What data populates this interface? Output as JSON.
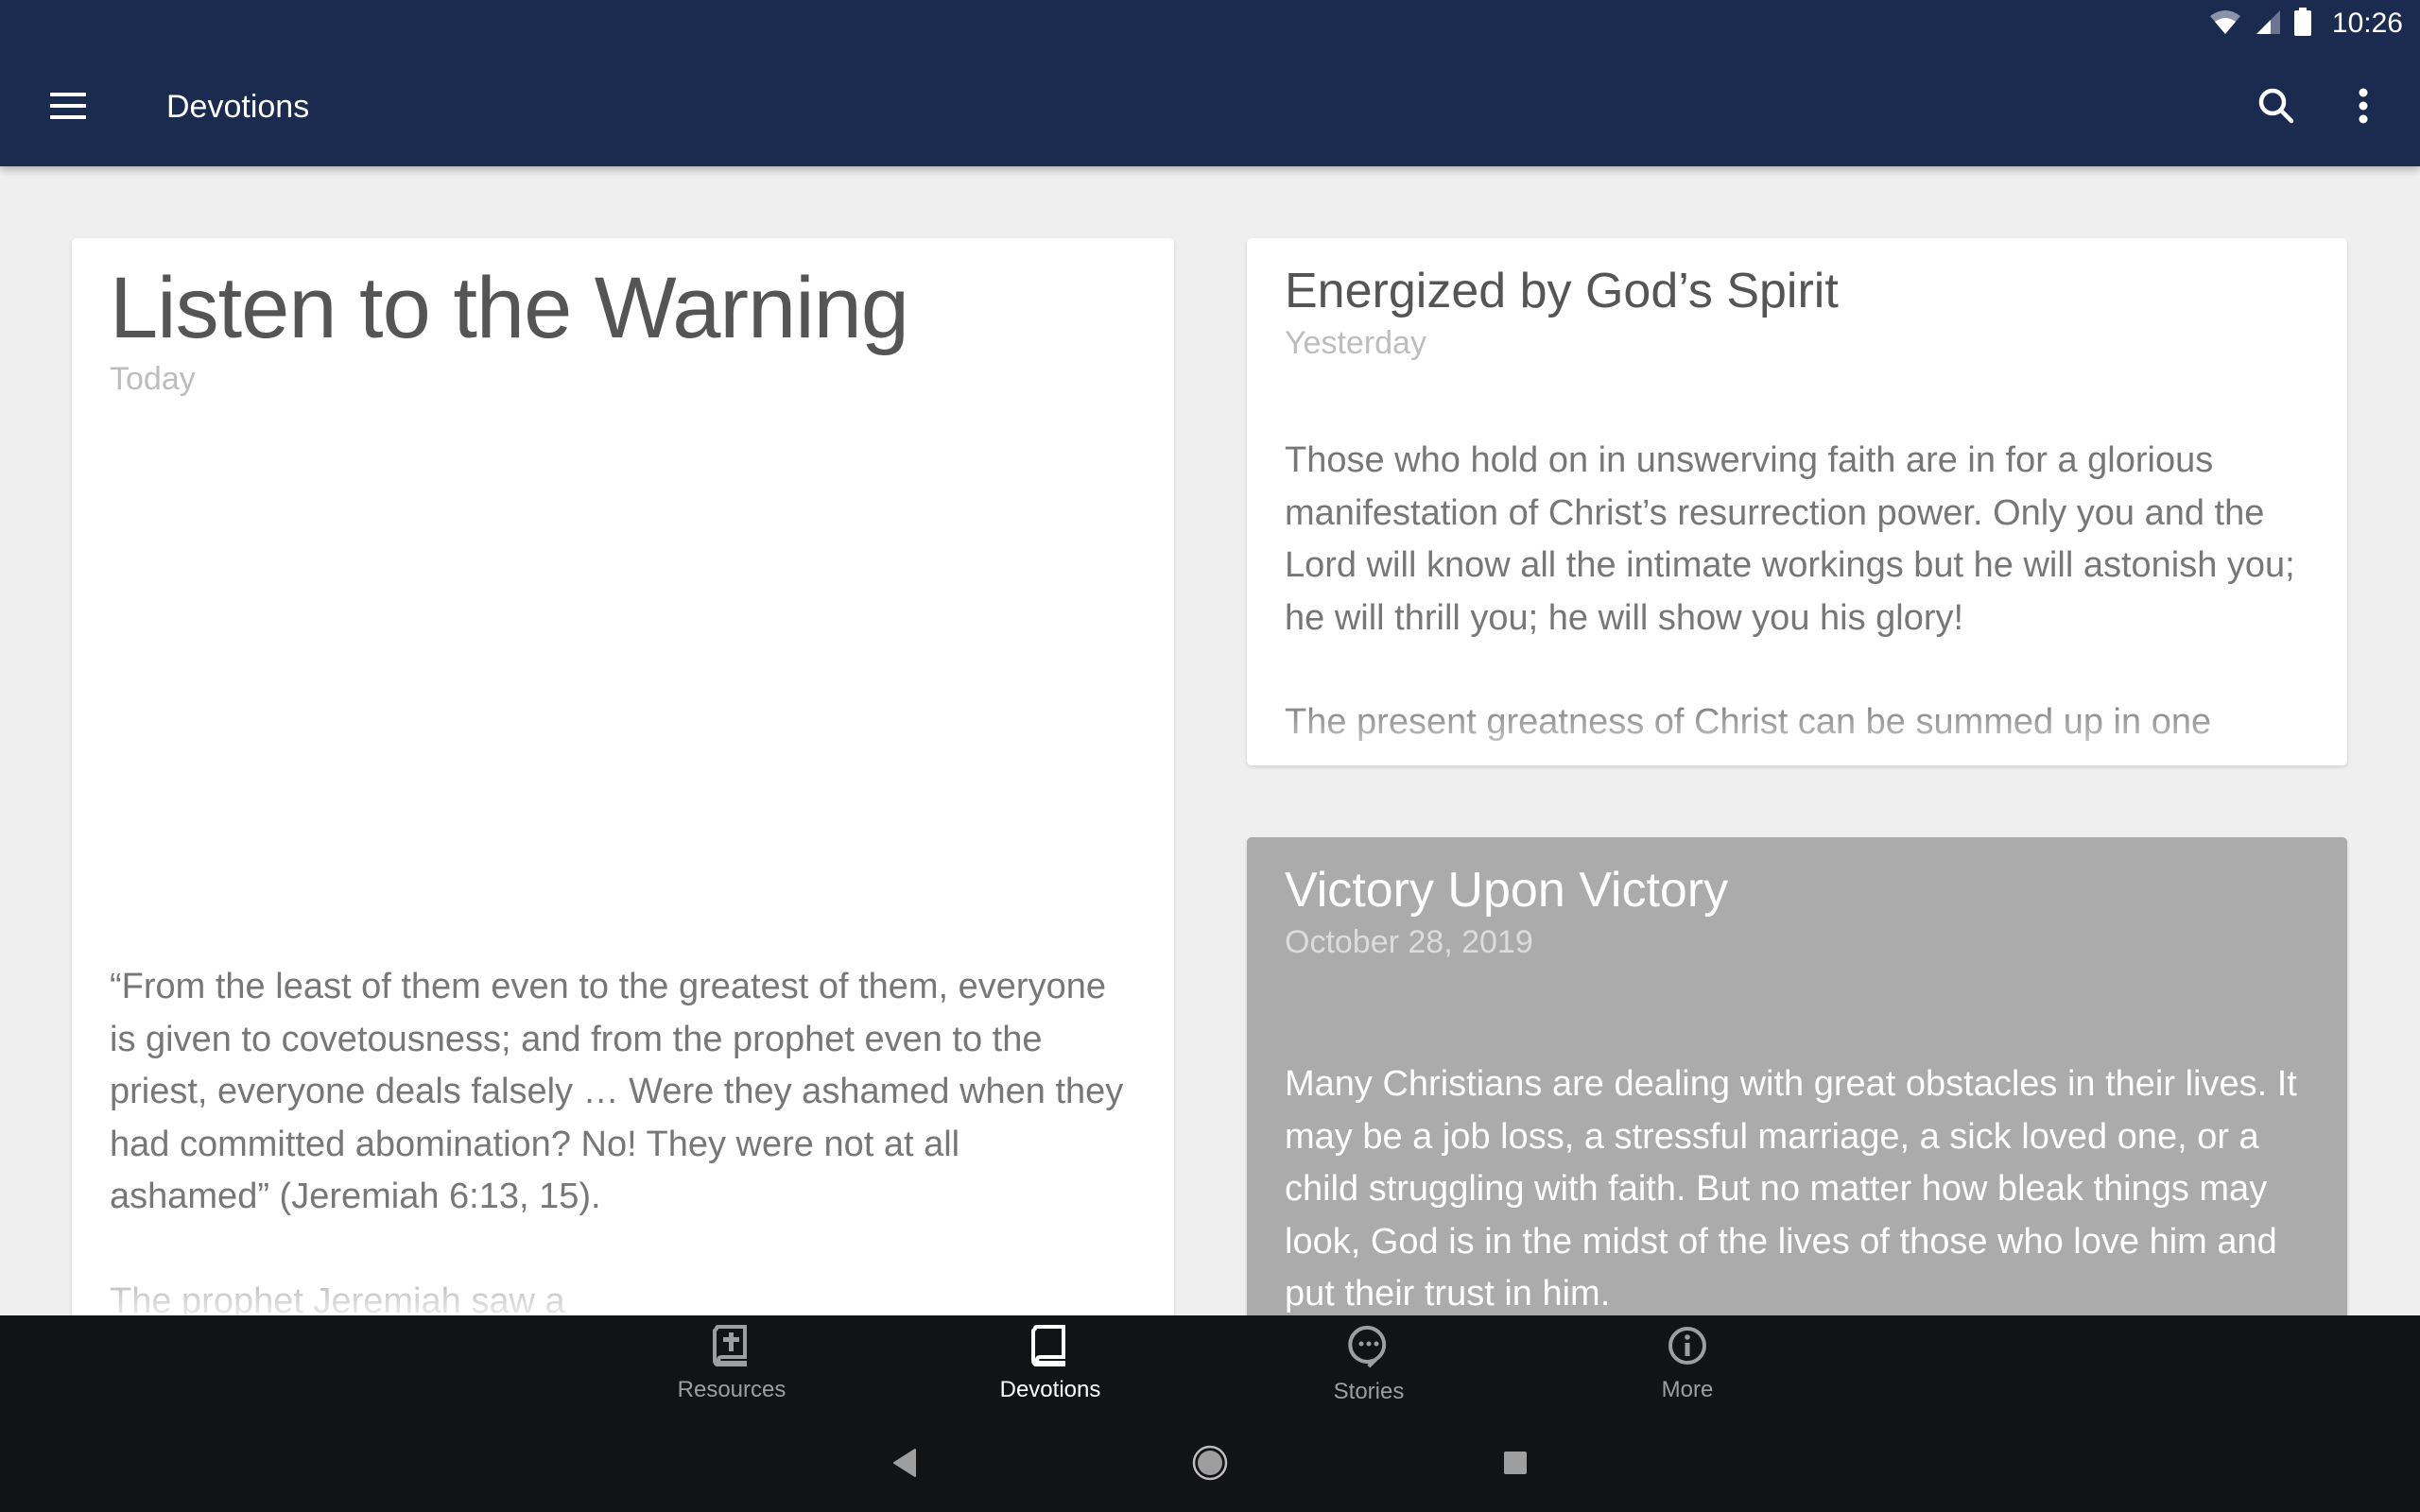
{
  "status_bar": {
    "time": "10:26",
    "icons": [
      "wifi-icon",
      "cell-signal-icon",
      "battery-icon"
    ]
  },
  "app_bar": {
    "title": "Devotions",
    "menu_icon": "hamburger-menu-icon",
    "search_icon": "search-icon",
    "more_icon": "more-vert-icon"
  },
  "colors": {
    "app_bar": "#1a2b4f",
    "background": "#efefef",
    "bottom_nav": "#121315",
    "selected_card": "#ababab",
    "nav_active": "#ffffff",
    "nav_inactive": "#9e9e9e"
  },
  "devotions": [
    {
      "title": "Listen to the Warning",
      "date": "Today",
      "paragraphs": [
        "“From the least of them even to the greatest of them, everyone is given to covetousness; and from the prophet even to the priest, everyone deals falsely … Were they ashamed when they had committed abomination? No! They were not at all ashamed” (Jeremiah 6:13, 15).",
        "The prophet Jeremiah saw a"
      ]
    },
    {
      "title": "Energized by God’s Spirit",
      "date": "Yesterday",
      "paragraphs": [
        "Those who hold on in unswerving faith are in for a glorious manifestation of Christ’s resurrection power. Only you and the Lord will know all the intimate workings but he will astonish you; he will thrill you; he will show you his glory!",
        "The present greatness of Christ can be summed up in one"
      ]
    },
    {
      "title": "Victory Upon Victory",
      "date": "October 28, 2019",
      "selected": true,
      "paragraphs": [
        "Many Christians are dealing with great obstacles in their lives. It may be a job loss, a stressful marriage, a sick loved one, or a child struggling with faith. But no matter how bleak things may look, God is in the midst of the lives of those who love him and put their trust in him."
      ]
    }
  ],
  "bottom_nav": {
    "items": [
      {
        "label": "Resources",
        "icon": "bible-icon",
        "active": false
      },
      {
        "label": "Devotions",
        "icon": "book-icon",
        "active": true
      },
      {
        "label": "Stories",
        "icon": "chat-bubble-icon",
        "active": false
      },
      {
        "label": "More",
        "icon": "info-icon",
        "active": false
      }
    ]
  },
  "system_nav": {
    "buttons": [
      "back",
      "home",
      "recents"
    ]
  }
}
